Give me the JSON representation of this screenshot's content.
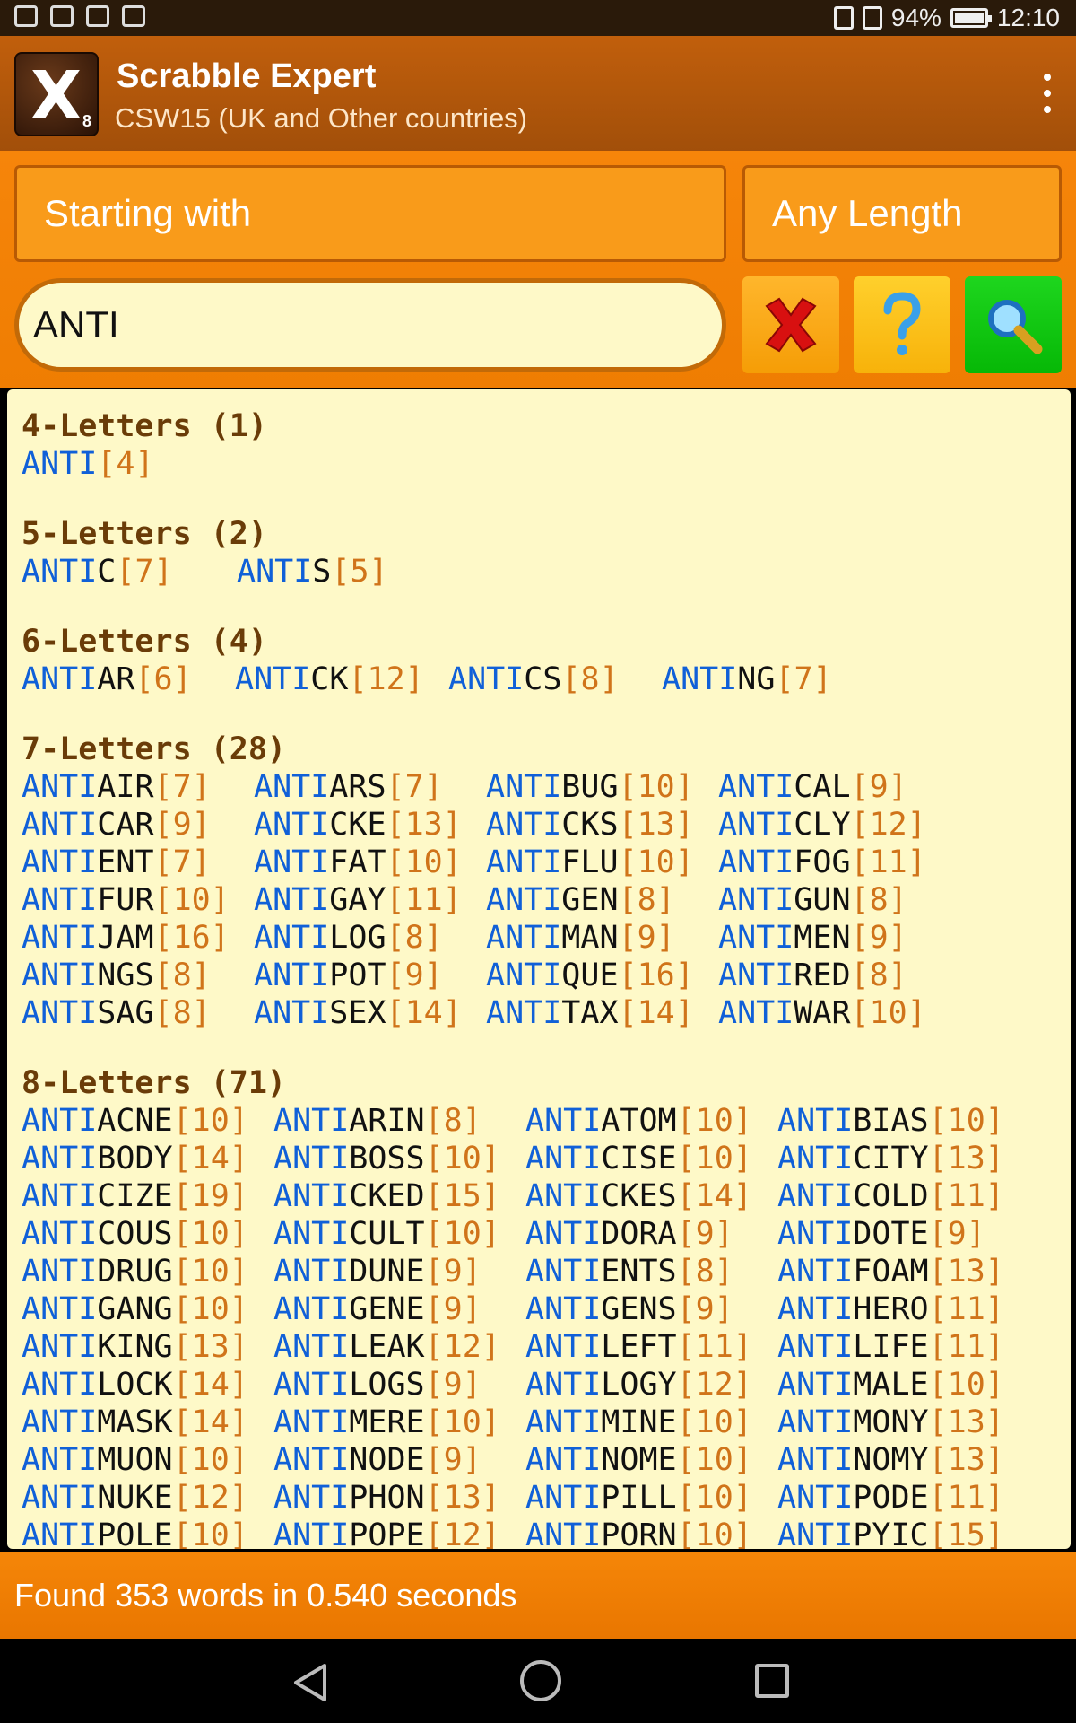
{
  "status": {
    "battery": "94%",
    "battery_level": 0.94,
    "time": "12:10"
  },
  "app": {
    "logo_letter": "X",
    "logo_value": "8",
    "title": "Scrabble Expert",
    "subtitle": "CSW15 (UK and Other countries)"
  },
  "controls": {
    "mode": "Starting with",
    "length": "Any Length",
    "query": "ANTI"
  },
  "results": {
    "prefix": "ANTI",
    "groups": [
      {
        "title": "4-Letters (1)",
        "words": [
          [
            "",
            "4"
          ]
        ]
      },
      {
        "title": "5-Letters (2)",
        "words": [
          [
            "C",
            "7"
          ],
          [
            "S",
            "5"
          ]
        ]
      },
      {
        "title": "6-Letters (4)",
        "words": [
          [
            "AR",
            "6"
          ],
          [
            "CK",
            "12"
          ],
          [
            "CS",
            "8"
          ],
          [
            "NG",
            "7"
          ]
        ]
      },
      {
        "title": "7-Letters (28)",
        "words": [
          [
            "AIR",
            "7"
          ],
          [
            "ARS",
            "7"
          ],
          [
            "BUG",
            "10"
          ],
          [
            "CAL",
            "9"
          ],
          [
            "CAR",
            "9"
          ],
          [
            "CKE",
            "13"
          ],
          [
            "CKS",
            "13"
          ],
          [
            "CLY",
            "12"
          ],
          [
            "ENT",
            "7"
          ],
          [
            "FAT",
            "10"
          ],
          [
            "FLU",
            "10"
          ],
          [
            "FOG",
            "11"
          ],
          [
            "FUR",
            "10"
          ],
          [
            "GAY",
            "11"
          ],
          [
            "GEN",
            "8"
          ],
          [
            "GUN",
            "8"
          ],
          [
            "JAM",
            "16"
          ],
          [
            "LOG",
            "8"
          ],
          [
            "MAN",
            "9"
          ],
          [
            "MEN",
            "9"
          ],
          [
            "NGS",
            "8"
          ],
          [
            "POT",
            "9"
          ],
          [
            "QUE",
            "16"
          ],
          [
            "RED",
            "8"
          ],
          [
            "SAG",
            "8"
          ],
          [
            "SEX",
            "14"
          ],
          [
            "TAX",
            "14"
          ],
          [
            "WAR",
            "10"
          ]
        ]
      },
      {
        "title": "8-Letters (71)",
        "words": [
          [
            "ACNE",
            "10"
          ],
          [
            "ARIN",
            "8"
          ],
          [
            "ATOM",
            "10"
          ],
          [
            "BIAS",
            "10"
          ],
          [
            "BODY",
            "14"
          ],
          [
            "BOSS",
            "10"
          ],
          [
            "CISE",
            "10"
          ],
          [
            "CITY",
            "13"
          ],
          [
            "CIZE",
            "19"
          ],
          [
            "CKED",
            "15"
          ],
          [
            "CKES",
            "14"
          ],
          [
            "COLD",
            "11"
          ],
          [
            "COUS",
            "10"
          ],
          [
            "CULT",
            "10"
          ],
          [
            "DORA",
            "9"
          ],
          [
            "DOTE",
            "9"
          ],
          [
            "DRUG",
            "10"
          ],
          [
            "DUNE",
            "9"
          ],
          [
            "ENTS",
            "8"
          ],
          [
            "FOAM",
            "13"
          ],
          [
            "GANG",
            "10"
          ],
          [
            "GENE",
            "9"
          ],
          [
            "GENS",
            "9"
          ],
          [
            "HERO",
            "11"
          ],
          [
            "KING",
            "13"
          ],
          [
            "LEAK",
            "12"
          ],
          [
            "LEFT",
            "11"
          ],
          [
            "LIFE",
            "11"
          ],
          [
            "LOCK",
            "14"
          ],
          [
            "LOGS",
            "9"
          ],
          [
            "LOGY",
            "12"
          ],
          [
            "MALE",
            "10"
          ],
          [
            "MASK",
            "14"
          ],
          [
            "MERE",
            "10"
          ],
          [
            "MINE",
            "10"
          ],
          [
            "MONY",
            "13"
          ],
          [
            "MUON",
            "10"
          ],
          [
            "NODE",
            "9"
          ],
          [
            "NOME",
            "10"
          ],
          [
            "NOMY",
            "13"
          ],
          [
            "NUKE",
            "12"
          ],
          [
            "PHON",
            "13"
          ],
          [
            "PILL",
            "10"
          ],
          [
            "PODE",
            "11"
          ],
          [
            "POLE",
            "10"
          ],
          [
            "POPE",
            "12"
          ],
          [
            "PORN",
            "10"
          ],
          [
            "PYIC",
            "15"
          ]
        ]
      }
    ]
  },
  "footer": {
    "summary": "Found 353 words in 0.540 seconds"
  }
}
